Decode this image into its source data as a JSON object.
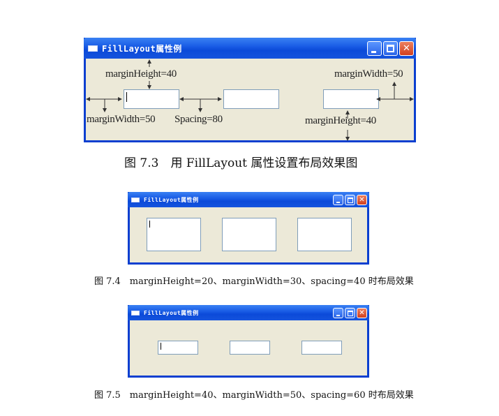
{
  "window": {
    "title": "FillLayout属性例"
  },
  "figure1": {
    "annotations": {
      "margin_height_top": "marginHeight=40",
      "margin_width_right": "marginWidth=50",
      "margin_width_left": "marginWidth=50",
      "spacing": "Spacing=80",
      "margin_height_bottom": "marginHeight=40"
    },
    "caption": "图 7.3　用 FillLayout 属性设置布局效果图"
  },
  "figure2": {
    "caption": "图 7.4　marginHeight=20、marginWidth=30、spacing=40 时布局效果"
  },
  "figure3": {
    "caption": "图 7.5　marginHeight=40、marginWidth=50、spacing=60 时布局效果"
  },
  "colors": {
    "titlebar": "#0b4ad9",
    "window_border": "#0a3fd0",
    "window_body": "#ece9d8",
    "close_button": "#d1401f"
  }
}
